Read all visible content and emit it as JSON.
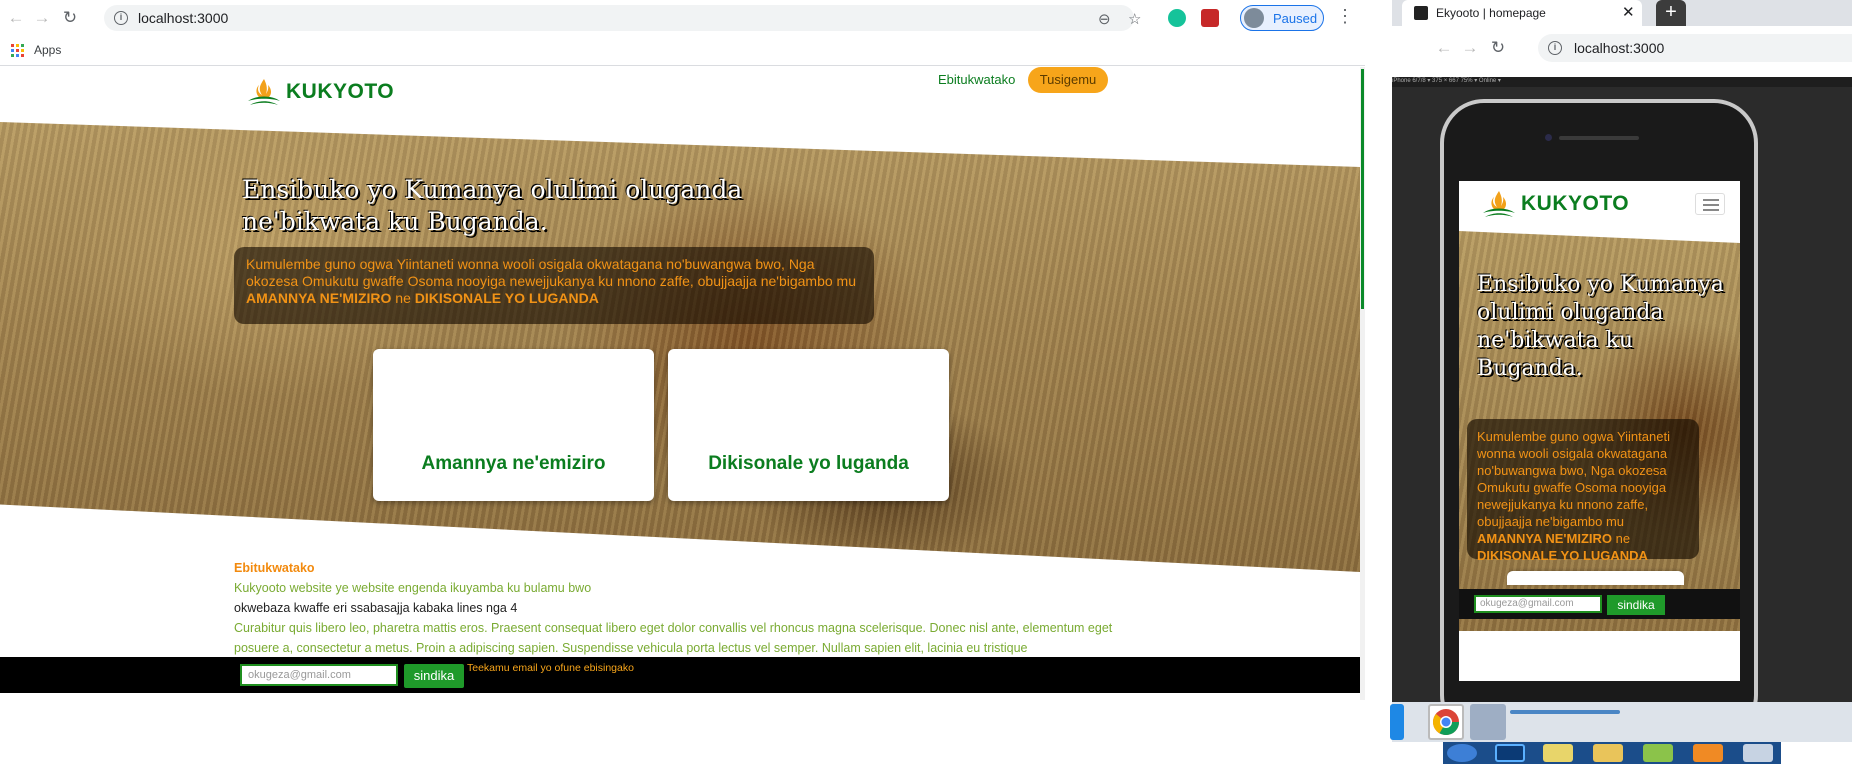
{
  "browser": {
    "url": "localhost:3000",
    "profile_status": "Paused",
    "bookmarks_apps": "Apps"
  },
  "site": {
    "brand": "KUKYOTO",
    "nav_link": "Ebitukwatako",
    "nav_button": "Tusigemu",
    "hero_title": "Ensibuko yo Kumanya olulimi oluganda ne'bikwata ku Buganda.",
    "hero_desc_prefix": "Kumulembe guno ogwa Yiintaneti wonna wooli osigala okwatagana no'buwangwa bwo, Nga okozesa Omukutu gwaffe Osoma nooyiga newejjukanya ku nnono zaffe, obujjaajja ne'bigambo mu ",
    "hero_desc_strong1": "AMANNYA NE'MIZIRO",
    "hero_desc_mid": " ne ",
    "hero_desc_strong2": "DIKISONALE YO LUGANDA",
    "cards": [
      "Amannya ne'emiziro",
      "Dikisonale yo luganda"
    ],
    "about_heading": "Ebitukwatako",
    "about_line1": "Kukyooto website ye website engenda ikuyamba ku bulamu bwo",
    "about_line2": "okwebaza kwaffe eri ssabasajja kabaka lines nga 4",
    "about_lorem": "Curabitur quis libero leo, pharetra mattis eros. Praesent consequat libero eget dolor convallis vel rhoncus magna scelerisque. Donec nisl ante, elementum eget posuere a, consectetur a metus. Proin a adipiscing sapien. Suspendisse vehicula porta lectus vel semper. Nullam sapien elit, lacinia eu tristique",
    "footer_email_placeholder": "okugeza@gmail.com",
    "footer_send": "sindika",
    "footer_msg": "Teekamu email yo ofune ebisingako"
  },
  "devtools_window": {
    "tab_title": "Ekyooto | homepage",
    "url": "localhost:3000",
    "device_bar": "iPhone 6/7/8 ▾   375  ×  667   75% ▾   Online ▾",
    "mobile_hero_title": "Ensibuko yo Kumanya olulimi oluganda ne'bikwata ku Buganda.",
    "mobile_desc_prefix": "Kumulembe guno ogwa Yiintaneti wonna wooli osigala okwatagana no'buwangwa bwo, Nga okozesa Omukutu gwaffe Osoma nooyiga newejjukanya ku nnono zaffe, obujjaajja ne'bigambo mu ",
    "mobile_desc_strong1": "AMANNYA NE'MIZIRO",
    "mobile_desc_mid": " ne ",
    "mobile_desc_strong2": "DIKISONALE YO LUGANDA",
    "mobile_email_placeholder": "okugeza@gmail.com",
    "mobile_send": "sindika"
  },
  "colors": {
    "brand_green": "#0b7d1f",
    "accent_orange": "#f7a51a",
    "text_orange": "#f29316"
  }
}
